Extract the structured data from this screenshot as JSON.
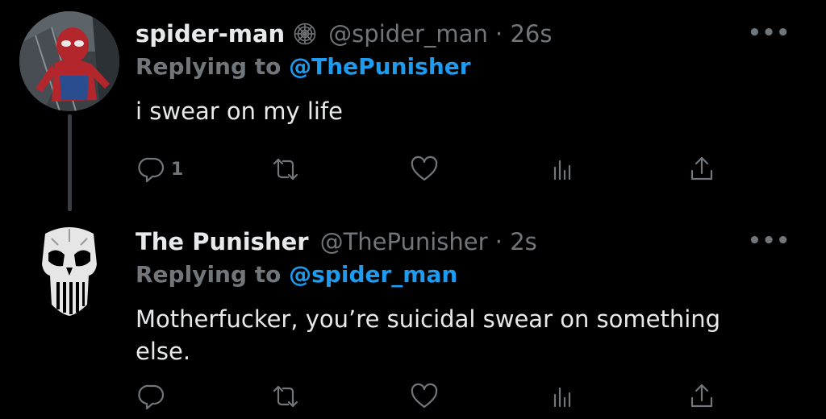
{
  "tweets": [
    {
      "display_name": "spider-man",
      "verified_badge": "spiderweb-icon",
      "handle_time": "@spider_man · 26s",
      "replying_to_label": "Replying to",
      "replying_to_handle": "@ThePunisher",
      "text": "i swear on my life",
      "reply_count": "1",
      "more_label": "•••"
    },
    {
      "display_name": "The Punisher",
      "handle_time": "@ThePunisher · 2s",
      "replying_to_label": "Replying to",
      "replying_to_handle": "@spider_man",
      "text": "Motherfucker, you’re suicidal swear on something else.",
      "reply_count": "",
      "more_label": "•••"
    }
  ],
  "colors": {
    "background": "#000000",
    "text": "#e7e9ea",
    "muted": "#71767b",
    "link": "#1d9bf0"
  }
}
